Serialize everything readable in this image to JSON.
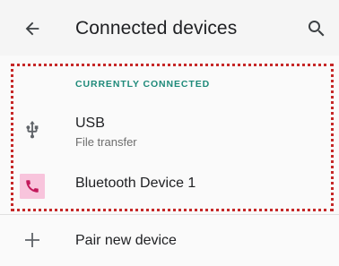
{
  "header": {
    "title": "Connected devices",
    "back_icon": "arrow-back-icon",
    "search_icon": "search-icon"
  },
  "connected": {
    "section_label": "CURRENTLY CONNECTED",
    "items": [
      {
        "title": "USB",
        "subtitle": "File transfer",
        "icon": "usb-icon"
      },
      {
        "title": "Bluetooth Device 1",
        "icon": "phone-icon"
      }
    ]
  },
  "pair": {
    "label": "Pair new device",
    "icon": "plus-icon"
  },
  "colors": {
    "accent": "#1f8a7a",
    "phone_icon": "#c2185b",
    "phone_icon_bg": "#f8c4dc",
    "highlight_border": "#c62828"
  }
}
